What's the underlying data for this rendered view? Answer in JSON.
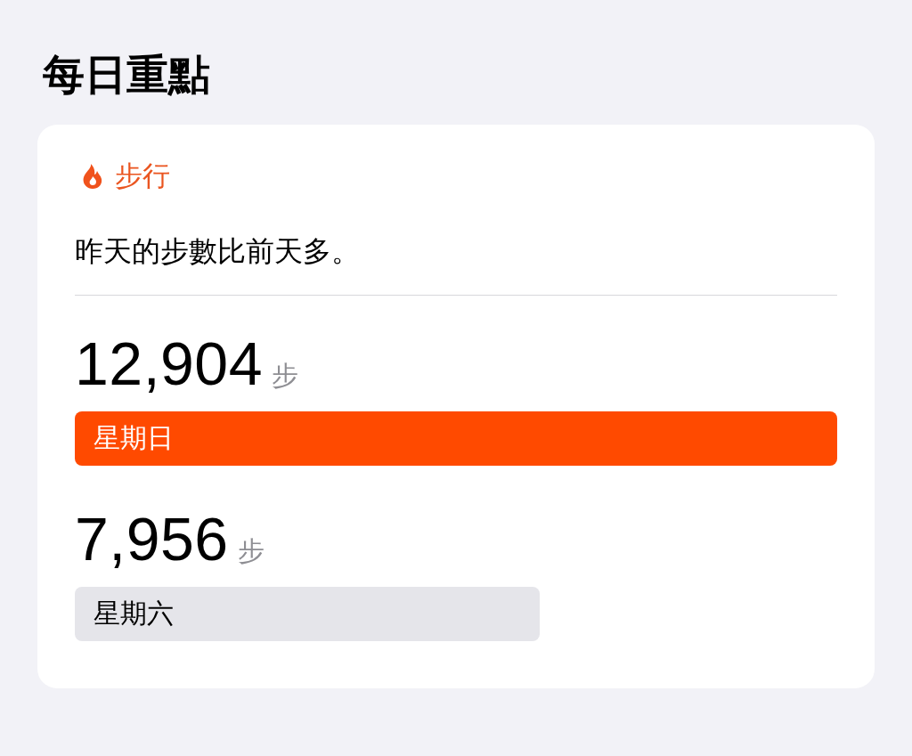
{
  "title": "每日重點",
  "card": {
    "category": {
      "label": "步行"
    },
    "summary": "昨天的步數比前天多。",
    "entries": [
      {
        "value": "12,904",
        "unit": "步",
        "day": "星期日",
        "level": 1,
        "highlighted": true
      },
      {
        "value": "7,956",
        "unit": "步",
        "day": "星期六",
        "level": 0.61,
        "highlighted": false
      }
    ]
  }
}
